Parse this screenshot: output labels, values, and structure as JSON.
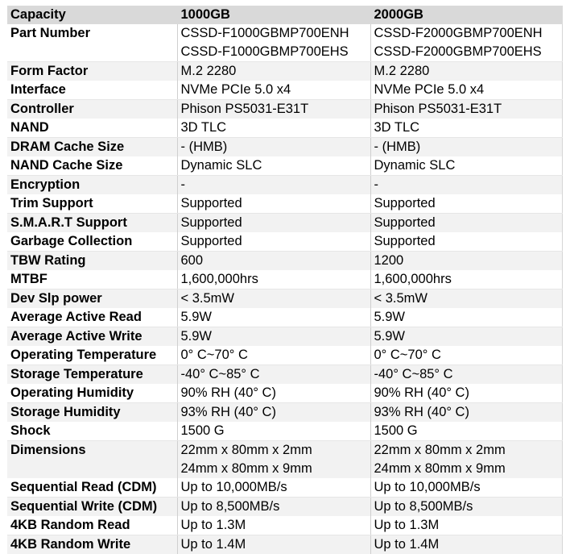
{
  "table": {
    "header": {
      "label": "Capacity",
      "col1": "1000GB",
      "col2": "2000GB"
    },
    "rows": [
      {
        "label": "Part Number",
        "v1": [
          "CSSD-F1000GBMP700ENH",
          "CSSD-F1000GBMP700EHS"
        ],
        "v2": [
          "CSSD-F2000GBMP700ENH",
          "CSSD-F2000GBMP700EHS"
        ]
      },
      {
        "label": "Form Factor",
        "v1": [
          "M.2 2280"
        ],
        "v2": [
          "M.2 2280"
        ]
      },
      {
        "label": "Interface",
        "v1": [
          "NVMe PCIe 5.0 x4"
        ],
        "v2": [
          "NVMe PCIe 5.0 x4"
        ]
      },
      {
        "label": "Controller",
        "v1": [
          "Phison PS5031-E31T"
        ],
        "v2": [
          "Phison PS5031-E31T"
        ]
      },
      {
        "label": "NAND",
        "v1": [
          "3D TLC"
        ],
        "v2": [
          "3D TLC"
        ]
      },
      {
        "label": "DRAM Cache Size",
        "v1": [
          "- (HMB)"
        ],
        "v2": [
          "- (HMB)"
        ]
      },
      {
        "label": "NAND Cache Size",
        "v1": [
          "Dynamic SLC"
        ],
        "v2": [
          "Dynamic SLC"
        ]
      },
      {
        "label": "Encryption",
        "v1": [
          "-"
        ],
        "v2": [
          "-"
        ]
      },
      {
        "label": "Trim Support",
        "v1": [
          "Supported"
        ],
        "v2": [
          "Supported"
        ]
      },
      {
        "label": "S.M.A.R.T Support",
        "v1": [
          "Supported"
        ],
        "v2": [
          "Supported"
        ]
      },
      {
        "label": "Garbage Collection",
        "v1": [
          "Supported"
        ],
        "v2": [
          "Supported"
        ]
      },
      {
        "label": "TBW Rating",
        "v1": [
          "600"
        ],
        "v2": [
          "1200"
        ]
      },
      {
        "label": "MTBF",
        "v1": [
          "1,600,000hrs"
        ],
        "v2": [
          "1,600,000hrs"
        ]
      },
      {
        "label": "Dev Slp power",
        "v1": [
          "< 3.5mW"
        ],
        "v2": [
          "< 3.5mW"
        ]
      },
      {
        "label": "Average Active Read",
        "v1": [
          "5.9W"
        ],
        "v2": [
          "5.9W"
        ]
      },
      {
        "label": "Average Active Write",
        "v1": [
          "5.9W"
        ],
        "v2": [
          "5.9W"
        ]
      },
      {
        "label": "Operating Temperature",
        "v1": [
          "0° C~70° C"
        ],
        "v2": [
          "0° C~70° C"
        ]
      },
      {
        "label": "Storage Temperature",
        "v1": [
          "-40° C~85° C"
        ],
        "v2": [
          "-40° C~85° C"
        ]
      },
      {
        "label": "Operating Humidity",
        "v1": [
          "90% RH (40° C)"
        ],
        "v2": [
          "90% RH (40° C)"
        ]
      },
      {
        "label": "Storage Humidity",
        "v1": [
          "93% RH (40° C)"
        ],
        "v2": [
          "93% RH (40° C)"
        ]
      },
      {
        "label": "Shock",
        "v1": [
          "1500 G"
        ],
        "v2": [
          "1500 G"
        ]
      },
      {
        "label": "Dimensions",
        "v1": [
          "22mm x 80mm x 2mm",
          "24mm x 80mm x 9mm"
        ],
        "v2": [
          "22mm x 80mm x 2mm",
          "24mm x 80mm x 9mm"
        ]
      },
      {
        "label": "Sequential Read (CDM)",
        "v1": [
          "Up to 10,000MB/s"
        ],
        "v2": [
          "Up to 10,000MB/s"
        ]
      },
      {
        "label": "Sequential Write (CDM)",
        "v1": [
          "Up to 8,500MB/s"
        ],
        "v2": [
          "Up to 8,500MB/s"
        ]
      },
      {
        "label": "4KB Random Read",
        "v1": [
          "Up to 1.3M"
        ],
        "v2": [
          "Up to 1.3M"
        ]
      },
      {
        "label": "4KB Random Write",
        "v1": [
          "Up to 1.4M"
        ],
        "v2": [
          "Up to 1.4M"
        ]
      }
    ]
  }
}
